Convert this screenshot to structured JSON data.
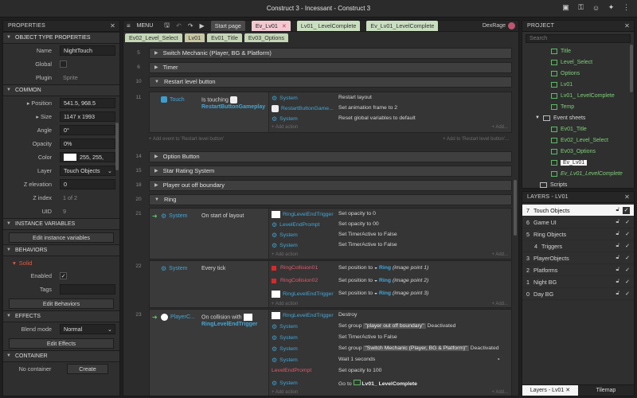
{
  "window": {
    "title": "Construct 3 - Incessant - Construct 3"
  },
  "properties": {
    "title": "PROPERTIES",
    "object_type_section": "OBJECT TYPE PROPERTIES",
    "name_label": "Name",
    "name_value": "NightTouch",
    "global_label": "Global",
    "plugin_label": "Plugin",
    "plugin_value": "Sprite",
    "common_section": "COMMON",
    "position_label": "Position",
    "position_value": "541.5, 968.5",
    "size_label": "Size",
    "size_value": "1147 x 1993",
    "angle_label": "Angle",
    "angle_value": "0°",
    "opacity_label": "Opacity",
    "opacity_value": "0%",
    "color_label": "Color",
    "color_value": "255, 255,",
    "layer_label": "Layer",
    "layer_value": "Touch Objects",
    "zelev_label": "Z elevation",
    "zelev_value": "0",
    "zindex_label": "Z index",
    "zindex_value": "1 of 2",
    "uid_label": "UID",
    "uid_value": "9",
    "instance_section": "INSTANCE VARIABLES",
    "edit_instance_btn": "Edit instance variables",
    "behaviors_section": "BEHAVIORS",
    "solid_label": "Solid",
    "enabled_label": "Enabled",
    "tags_label": "Tags",
    "edit_behaviors_btn": "Edit Behaviors",
    "effects_section": "EFFECTS",
    "blend_label": "Blend mode",
    "blend_value": "Normal",
    "edit_effects_btn": "Edit Effects",
    "container_section": "CONTAINER",
    "no_container": "No container",
    "create_btn": "Create"
  },
  "toolbar": {
    "menu": "MENU",
    "tabs": [
      "Start page",
      "Ev_Lv01",
      "Lv01_ LevelComplete",
      "Ev_Lv01_LevelComplete"
    ],
    "tabs2": [
      "Ev02_Level_Select",
      "Lv01",
      "Ev01_Title",
      "Ev03_Options"
    ],
    "user": "DexRage"
  },
  "sheet": {
    "groups": {
      "g5": {
        "num": "5",
        "label": "Switch Mechanic (Player, BG & Platform)"
      },
      "g6": {
        "num": "6",
        "label": "Timer"
      },
      "g10": {
        "num": "10",
        "label": "Restart level button"
      },
      "g14": {
        "num": "14",
        "label": "Option Button"
      },
      "g15": {
        "num": "15",
        "label": "Star Rating System"
      },
      "g18": {
        "num": "18",
        "label": "Player out off boundary"
      },
      "g20": {
        "num": "20",
        "label": "Ring"
      }
    },
    "ev11": {
      "num": "11",
      "cond_obj": "Touch",
      "cond_txt": "Is touching",
      "cond_lnk": "RestartButtonGameplay",
      "a1_obj": "System",
      "a1_txt": "Restart layout",
      "a2_obj": "RestartButtonGame...",
      "a2_txt": "Set animation frame to 2",
      "a3_obj": "System",
      "a3_txt": "Reset global variables to default",
      "add_action": "Add action",
      "add_event": "Add event to 'Restart level button'",
      "add_text": "Add to 'Restart level button'...",
      "add_more": "Add..."
    },
    "ev21": {
      "num": "21",
      "cond_obj": "System",
      "cond_txt": "On start of layout",
      "a1_obj": "RingLevelEndTrigger",
      "a1_txt": "Set opacity to 0",
      "a2_obj": "LevelEndPrompt",
      "a2_txt": "Set opacity to 00",
      "a3_obj": "System",
      "a3_txt": "Set TimerActive to False",
      "a4_obj": "System",
      "a4_txt": "Set TimerActive to False",
      "add_action": "Add action",
      "add_more": "Add..."
    },
    "ev22": {
      "num": "22",
      "cond_obj": "System",
      "cond_txt": "Every tick",
      "a1_obj": "RingCollision01",
      "a1_txt": "Set position to",
      "a1_ring": "Ring",
      "a1_pt": "(image point 1)",
      "a2_obj": "RingCollision02",
      "a2_txt": "Set position to",
      "a2_ring": "Ring",
      "a2_pt": "(image point 2)",
      "a3_obj": "RingLevelEndTrigger",
      "a3_txt": "Set position to",
      "a3_ring": "Ring",
      "a3_pt": "(image point 3)",
      "add_action": "Add action",
      "add_more": "Add..."
    },
    "ev23": {
      "num": "23",
      "cond_obj": "PlayerC...",
      "cond_txt": "On collision with",
      "cond_lnk": "RingLevelEndTrigger",
      "a1_obj": "RingLevelEndTrigger",
      "a1_txt": "Destroy",
      "a2_obj": "System",
      "a2_txt": "Set group",
      "a2_str": "\"player out off boundary\"",
      "a2_tail": "Deactivated",
      "a3_obj": "System",
      "a3_txt": "Set TimerActive to False",
      "a4_obj": "System",
      "a4_txt": "Set group",
      "a4_str": "\"Switch Mechanic (Player, BG & Platform)\"",
      "a4_tail": "Deactivated",
      "a5_obj": "System",
      "a5_txt": "Wait 1 seconds",
      "a6_obj": "LevelEndPrompt",
      "a6_txt": "Set opacity to 100",
      "a7_obj": "System",
      "a7_txt": "Go to",
      "a7_lnk": "Lv01_ LevelComplete",
      "add_action": "Add action",
      "add_more": "Add..."
    }
  },
  "project": {
    "title": "PROJECT",
    "search_placeholder": "Search",
    "items": [
      "Title",
      "Level_Select",
      "Options",
      "Lv01",
      "Lv01_ LevelComplete",
      "Temp"
    ],
    "event_sheets": "Event sheets",
    "sheets": [
      "Ev01_Title",
      "Ev02_Level_Select",
      "Ev03_Options",
      "Ev_Lv01",
      "Ev_Lv01_LevelComplete"
    ],
    "scripts": "Scripts"
  },
  "layers": {
    "title": "LAYERS - LV01",
    "items": [
      {
        "n": "7",
        "name": "Touch Objects"
      },
      {
        "n": "6",
        "name": "Game UI"
      },
      {
        "n": "5",
        "name": "Ring Objects"
      },
      {
        "n": "4",
        "name": "Triggers"
      },
      {
        "n": "3",
        "name": "PlayerObjects"
      },
      {
        "n": "2",
        "name": "Platforms"
      },
      {
        "n": "1",
        "name": "Night BG"
      },
      {
        "n": "0",
        "name": "Day BG"
      }
    ],
    "tab_layers": "Layers - Lv01",
    "tab_tilemap": "Tilemap"
  }
}
